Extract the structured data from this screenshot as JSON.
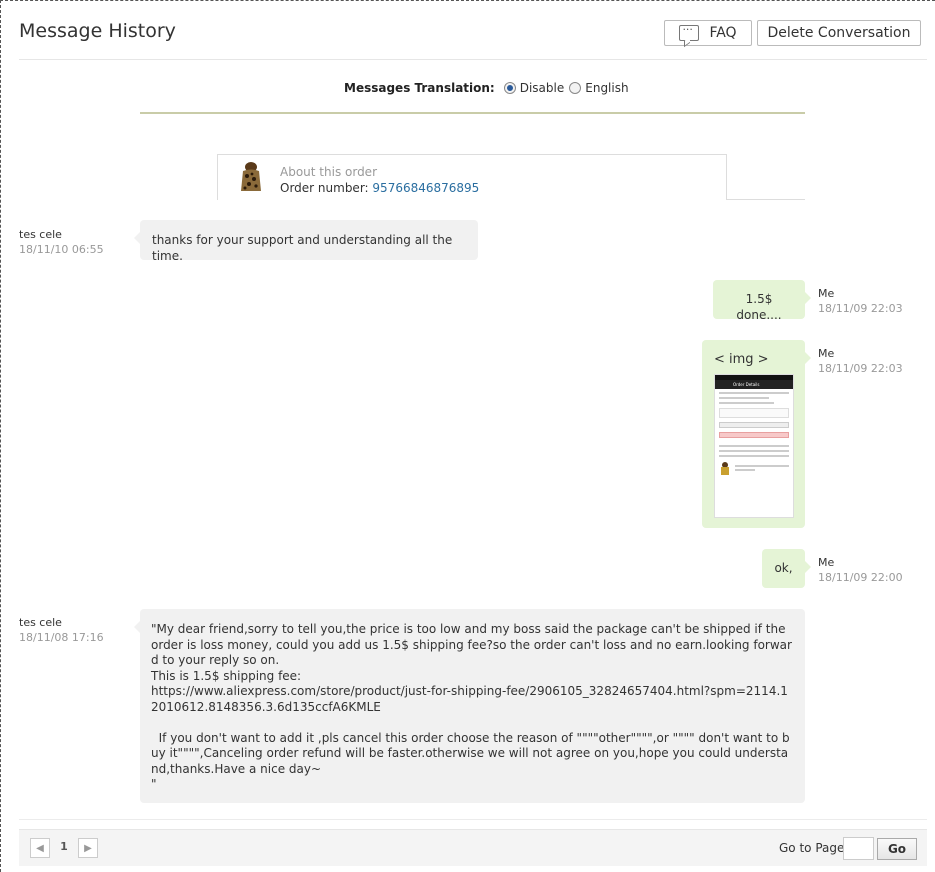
{
  "header": {
    "title": "Message History",
    "faq_label": "FAQ",
    "delete_label": "Delete Conversation"
  },
  "translation": {
    "label": "Messages Translation:",
    "options": [
      "Disable",
      "English"
    ],
    "selected": "Disable"
  },
  "order": {
    "about": "About this order",
    "number_label": "Order number:",
    "number": "95766846876895"
  },
  "messages": [
    {
      "sender": "tes cele",
      "time": "18/11/10 06:55",
      "text": "thanks for your support and understanding all the time.",
      "side": "left"
    },
    {
      "sender": "Me",
      "time": "18/11/09 22:03",
      "text": "1.5$ done....",
      "side": "right"
    },
    {
      "sender": "Me",
      "time": "18/11/09 22:03",
      "text": "< img >",
      "side": "right"
    },
    {
      "sender": "Me",
      "time": "18/11/09 22:00",
      "text": "ok,",
      "side": "right"
    },
    {
      "sender": "tes cele",
      "time": "18/11/08 17:16",
      "text": "\"My dear friend,sorry to tell you,the price is too low and my boss said the package can't be shipped if the order is loss money, could you add us 1.5$ shipping fee?so the order can't loss and no earn.looking forward to your reply so on.\nThis is 1.5$ shipping fee:\nhttps://www.aliexpress.com/store/product/just-for-shipping-fee/2906105_32824657404.html?spm=2114.12010612.8148356.3.6d135ccfA6KMLE\n\n  If you don't want to add it ,pls cancel this order choose the reason of \"\"\"\"other\"\"\"\",or \"\"\"\" don't want to buy it\"\"\"\",Canceling order refund will be faster.otherwise we will not agree on you,hope you could understand,thanks.Have a nice day~\n\"",
      "side": "left"
    }
  ],
  "pager": {
    "current_page": "1",
    "goto_label": "Go to Page",
    "go_label": "Go"
  },
  "colors": {
    "bubble_left": "#f1f1f1",
    "bubble_right": "#e5f4d6",
    "link": "#2a6ea0",
    "divider": "#c9cca8"
  }
}
